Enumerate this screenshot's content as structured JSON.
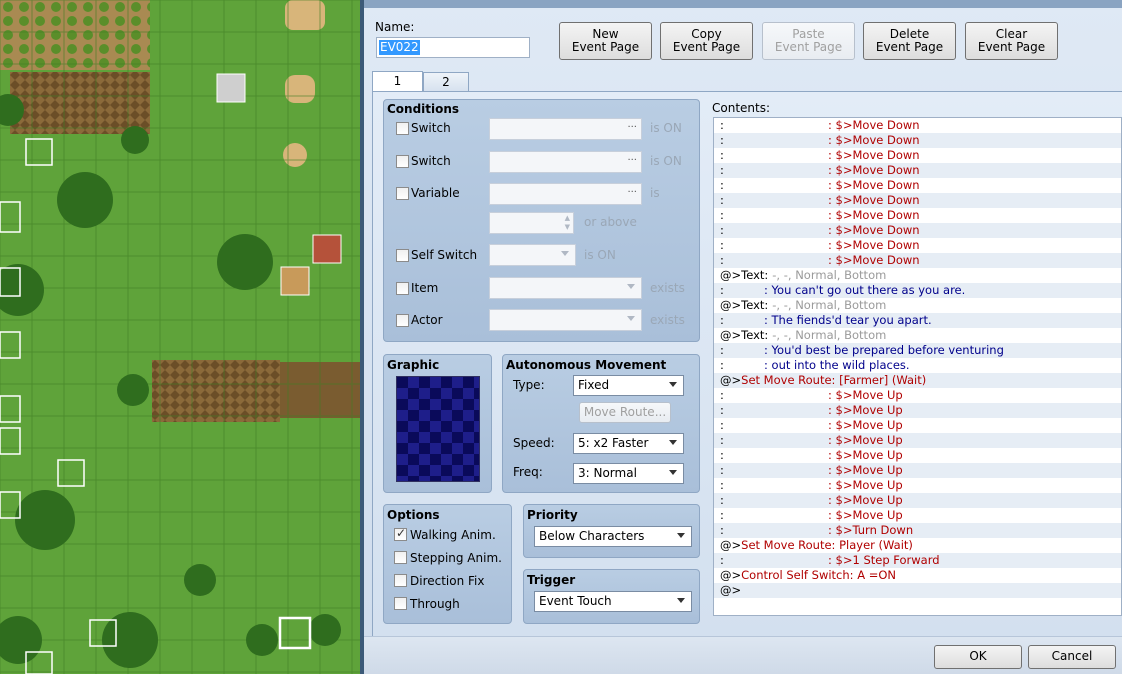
{
  "map": {},
  "name_label": "Name:",
  "name_value": "EV022",
  "buttons": {
    "new": [
      "New",
      "Event Page"
    ],
    "copy": [
      "Copy",
      "Event Page"
    ],
    "paste": [
      "Paste",
      "Event Page"
    ],
    "delete": [
      "Delete",
      "Event Page"
    ],
    "clear": [
      "Clear",
      "Event Page"
    ]
  },
  "tabs": [
    "1",
    "2"
  ],
  "conditions": {
    "title": "Conditions",
    "switch1": "Switch",
    "switch2": "Switch",
    "variable": "Variable",
    "self_switch": "Self Switch",
    "item": "Item",
    "actor": "Actor",
    "is_on": "is ON",
    "is": "is",
    "or_above": "or above",
    "exists": "exists",
    "dots": "..."
  },
  "graphic": {
    "title": "Graphic"
  },
  "autonomous": {
    "title": "Autonomous Movement",
    "type_label": "Type:",
    "type_value": "Fixed",
    "move_route": "Move Route...",
    "speed_label": "Speed:",
    "speed_value": "5: x2 Faster",
    "freq_label": "Freq:",
    "freq_value": "3: Normal"
  },
  "options": {
    "title": "Options",
    "items": [
      {
        "label": "Walking Anim.",
        "checked": true
      },
      {
        "label": "Stepping Anim.",
        "checked": false
      },
      {
        "label": "Direction Fix",
        "checked": false
      },
      {
        "label": "Through",
        "checked": false
      }
    ]
  },
  "priority": {
    "title": "Priority",
    "value": "Below Characters"
  },
  "trigger": {
    "title": "Trigger",
    "value": "Event Touch"
  },
  "contents_label": "Contents:",
  "contents": [
    {
      "pre": ":",
      "text": ": $>Move Down",
      "cls": "r-red",
      "indent": 108
    },
    {
      "pre": ":",
      "text": ": $>Move Down",
      "cls": "r-red",
      "indent": 108
    },
    {
      "pre": ":",
      "text": ": $>Move Down",
      "cls": "r-red",
      "indent": 108
    },
    {
      "pre": ":",
      "text": ": $>Move Down",
      "cls": "r-red",
      "indent": 108
    },
    {
      "pre": ":",
      "text": ": $>Move Down",
      "cls": "r-red",
      "indent": 108
    },
    {
      "pre": ":",
      "text": ": $>Move Down",
      "cls": "r-red",
      "indent": 108
    },
    {
      "pre": ":",
      "text": ": $>Move Down",
      "cls": "r-red",
      "indent": 108
    },
    {
      "pre": ":",
      "text": ": $>Move Down",
      "cls": "r-red",
      "indent": 108
    },
    {
      "pre": ":",
      "text": ": $>Move Down",
      "cls": "r-red",
      "indent": 108
    },
    {
      "pre": ":",
      "text": ": $>Move Down",
      "cls": "r-red",
      "indent": 108
    },
    {
      "pre": "@>Text:",
      "text": "-, -, Normal, Bottom",
      "cls": "r-gray",
      "indent": 0
    },
    {
      "pre": ":",
      "text": ": You can't go out there as you are.",
      "cls": "r-blue",
      "indent": 44
    },
    {
      "pre": "@>Text:",
      "text": "-, -, Normal, Bottom",
      "cls": "r-gray",
      "indent": 0
    },
    {
      "pre": ":",
      "text": ": The fiends'd tear you apart.",
      "cls": "r-blue",
      "indent": 44
    },
    {
      "pre": "@>Text:",
      "text": "-, -, Normal, Bottom",
      "cls": "r-gray",
      "indent": 0
    },
    {
      "pre": ":",
      "text": ": You'd best be prepared before venturing",
      "cls": "r-blue",
      "indent": 44
    },
    {
      "pre": ":",
      "text": ": out into the wild places.",
      "cls": "r-blue",
      "indent": 44
    },
    {
      "pre": "@>",
      "text": "Set Move Route: [Farmer] (Wait)",
      "cls": "r-red",
      "indent": 0
    },
    {
      "pre": ":",
      "text": ": $>Move Up",
      "cls": "r-red",
      "indent": 108
    },
    {
      "pre": ":",
      "text": ": $>Move Up",
      "cls": "r-red",
      "indent": 108
    },
    {
      "pre": ":",
      "text": ": $>Move Up",
      "cls": "r-red",
      "indent": 108
    },
    {
      "pre": ":",
      "text": ": $>Move Up",
      "cls": "r-red",
      "indent": 108
    },
    {
      "pre": ":",
      "text": ": $>Move Up",
      "cls": "r-red",
      "indent": 108
    },
    {
      "pre": ":",
      "text": ": $>Move Up",
      "cls": "r-red",
      "indent": 108
    },
    {
      "pre": ":",
      "text": ": $>Move Up",
      "cls": "r-red",
      "indent": 108
    },
    {
      "pre": ":",
      "text": ": $>Move Up",
      "cls": "r-red",
      "indent": 108
    },
    {
      "pre": ":",
      "text": ": $>Move Up",
      "cls": "r-red",
      "indent": 108
    },
    {
      "pre": ":",
      "text": ": $>Turn Down",
      "cls": "r-red",
      "indent": 108
    },
    {
      "pre": "@>",
      "text": "Set Move Route: Player (Wait)",
      "cls": "r-red",
      "indent": 0
    },
    {
      "pre": ":",
      "text": ": $>1 Step Forward",
      "cls": "r-red",
      "indent": 108
    },
    {
      "pre": "@>",
      "text": "Control Self Switch: A =ON",
      "cls": "r-red",
      "indent": 0
    },
    {
      "pre": "@>",
      "text": "",
      "cls": "",
      "indent": 0
    }
  ],
  "ok": "OK",
  "cancel": "Cancel",
  "colors": {
    "grass": "#5fa33a",
    "accent": "#3399ff",
    "red_text": "#b00000",
    "blue_text": "#00008b"
  }
}
